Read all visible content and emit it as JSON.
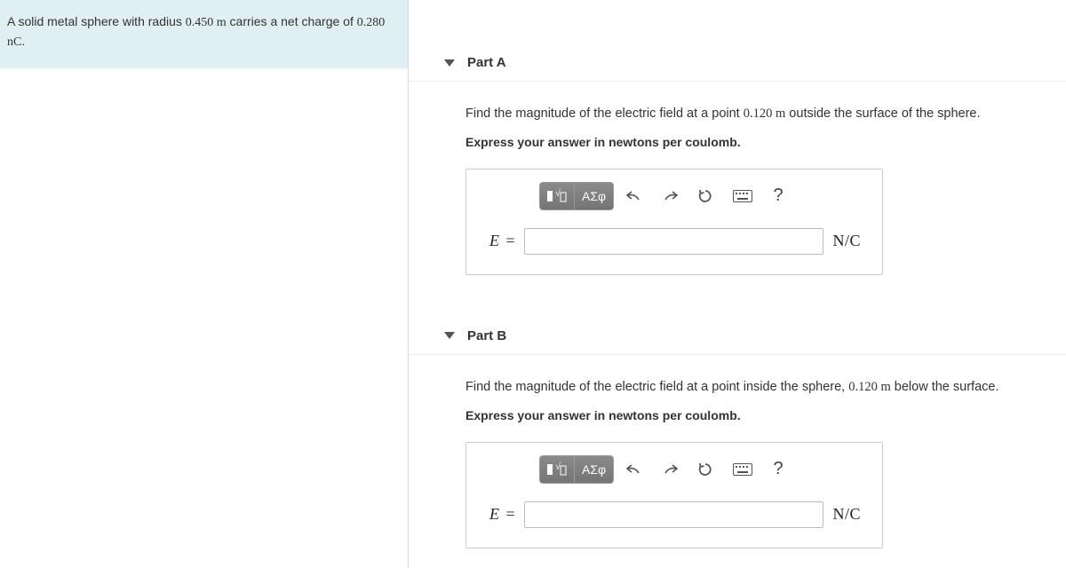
{
  "problem": {
    "text_before_radius": "A solid metal sphere with radius ",
    "radius": "0.450 m",
    "text_mid": " carries a net charge of ",
    "charge": "0.280 nC",
    "text_end": "."
  },
  "parts": [
    {
      "label": "Part A",
      "prompt_before": "Find the magnitude of the electric field at a point ",
      "prompt_val": "0.120 m",
      "prompt_after": " outside the surface of the sphere.",
      "instruction": "Express your answer in newtons per coulomb.",
      "lhs_symbol": "E",
      "units": "N/C"
    },
    {
      "label": "Part B",
      "prompt_before": "Find the magnitude of the electric field at a point inside the sphere, ",
      "prompt_val": "0.120 m",
      "prompt_after": " below the surface.",
      "instruction": "Express your answer in newtons per coulomb.",
      "lhs_symbol": "E",
      "units": "N/C"
    }
  ],
  "toolbar": {
    "symbols": "ΑΣφ",
    "help": "?"
  }
}
